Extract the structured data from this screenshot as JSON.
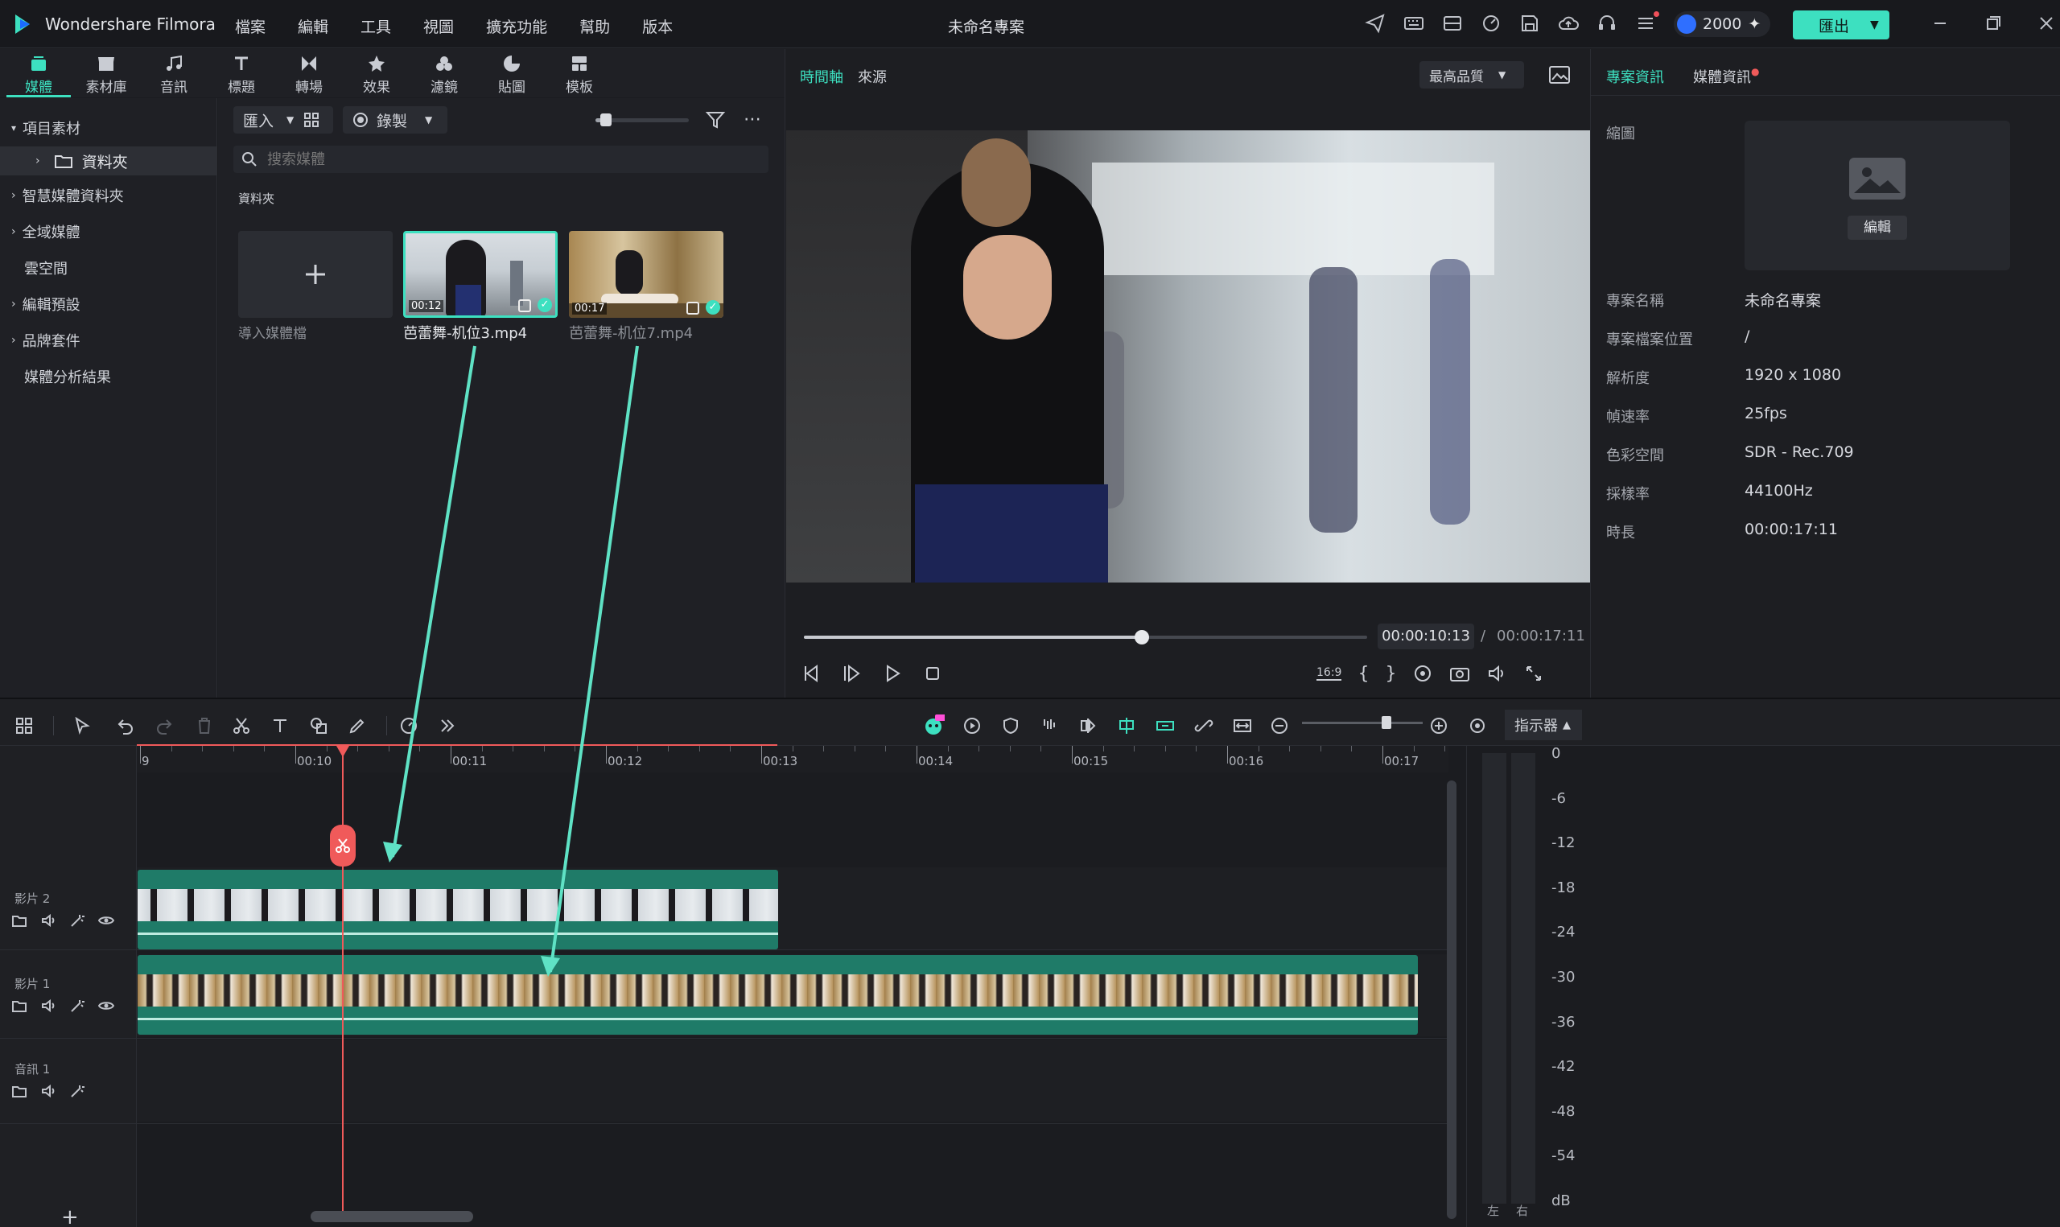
{
  "app": {
    "name": "Wondershare Filmora",
    "project_title": "未命名專案",
    "credits": "2000",
    "export_label": "匯出"
  },
  "menu": [
    "檔案",
    "編輯",
    "工具",
    "視圖",
    "擴充功能",
    "幫助",
    "版本"
  ],
  "media_tabs": [
    "媒體",
    "素材庫",
    "音訊",
    "標題",
    "轉場",
    "效果",
    "濾鏡",
    "貼圖",
    "模板"
  ],
  "sidebar": {
    "project_media": "項目素材",
    "folder": "資料夾",
    "items": [
      "智慧媒體資料夾",
      "全域媒體",
      "雲空間",
      "編輯預設",
      "品牌套件",
      "媒體分析結果"
    ]
  },
  "library": {
    "import_label": "匯入",
    "record_label": "錄製",
    "search_placeholder": "搜索媒體",
    "folder_title": "資料夾",
    "import_tile_label": "導入媒體檔",
    "clips": [
      {
        "name": "芭蕾舞-机位3.mp4",
        "duration": "00:12"
      },
      {
        "name": "芭蕾舞-机位7.mp4",
        "duration": "00:17"
      }
    ]
  },
  "preview": {
    "tabs": [
      "時間軸",
      "來源"
    ],
    "quality": "最高品質",
    "current_time": "00:00:10:13",
    "total_time": "00:00:17:11",
    "progress": 0.6,
    "ratio_label": "16:9"
  },
  "properties": {
    "tabs": [
      "專案資訊",
      "媒體資訊"
    ],
    "thumbnail_label": "縮圖",
    "edit_label": "編輯",
    "rows": [
      {
        "label": "專案名稱",
        "value": "未命名專案"
      },
      {
        "label": "專案檔案位置",
        "value": "/"
      },
      {
        "label": "解析度",
        "value": "1920 x 1080"
      },
      {
        "label": "幀速率",
        "value": "25fps"
      },
      {
        "label": "色彩空間",
        "value": "SDR - Rec.709"
      },
      {
        "label": "採樣率",
        "value": "44100Hz"
      },
      {
        "label": "時長",
        "value": "00:00:17:11"
      }
    ]
  },
  "timeline": {
    "meter_label": "指示器",
    "ruler": [
      "9",
      "00:10",
      "00:11",
      "00:12",
      "00:13",
      "00:14",
      "00:15",
      "00:16",
      "00:17"
    ],
    "tracks": [
      "影片 2",
      "影片 1",
      "音訊 1"
    ],
    "db_scale": [
      "0",
      "-6",
      "-12",
      "-18",
      "-24",
      "-30",
      "-36",
      "-42",
      "-48",
      "-54",
      "dB"
    ],
    "channels": [
      "左",
      "右"
    ],
    "zoom_level": 0.7
  },
  "colors": {
    "accent": "#3de0c0",
    "playhead": "#f05a5a",
    "clip": "#1f7b68",
    "bg": "#1b1c20"
  }
}
